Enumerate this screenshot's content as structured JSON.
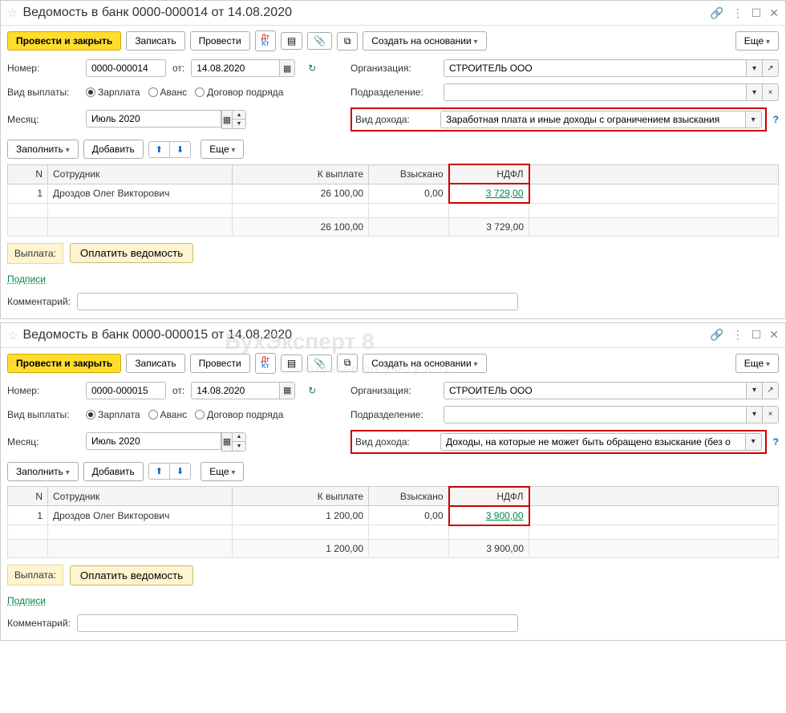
{
  "windows": [
    {
      "title": "Ведомость в банк 0000-000014 от 14.08.2020",
      "number": "0000-000014",
      "date": "14.08.2020",
      "org": "СТРОИТЕЛЬ ООО",
      "subdiv": "",
      "month": "Июль 2020",
      "income_type": "Заработная плата и иные доходы с ограничением взыскания",
      "row": {
        "n": "1",
        "emp": "Дроздов Олег Викторович",
        "amount": "26 100,00",
        "collected": "0,00",
        "ndfl": "3 729,00"
      },
      "total": {
        "amount": "26 100,00",
        "ndfl": "3 729,00"
      }
    },
    {
      "title": "Ведомость в банк 0000-000015 от 14.08.2020",
      "number": "0000-000015",
      "date": "14.08.2020",
      "org": "СТРОИТЕЛЬ ООО",
      "subdiv": "",
      "month": "Июль 2020",
      "income_type": "Доходы, на которые не может быть обращено взыскание (без о",
      "row": {
        "n": "1",
        "emp": "Дроздов Олег Викторович",
        "amount": "1 200,00",
        "collected": "0,00",
        "ndfl": "3 900,00"
      },
      "total": {
        "amount": "1 200,00",
        "ndfl": "3 900,00"
      }
    }
  ],
  "labels": {
    "post_close": "Провести и закрыть",
    "record": "Записать",
    "post": "Провести",
    "create_based": "Создать на основании",
    "more": "Еще",
    "number": "Номер:",
    "from": "от:",
    "org": "Организация:",
    "paytype": "Вид выплаты:",
    "salary": "Зарплата",
    "advance": "Аванс",
    "contract": "Договор подряда",
    "subdiv": "Подразделение:",
    "month": "Месяц:",
    "income_type": "Вид дохода:",
    "fill": "Заполнить",
    "add": "Добавить",
    "col_n": "N",
    "col_emp": "Сотрудник",
    "col_amt": "К выплате",
    "col_col": "Взыскано",
    "col_ndfl": "НДФЛ",
    "payment": "Выплата:",
    "pay_btn": "Оплатить ведомость",
    "signs": "Подписи",
    "comment": "Комментарий:"
  },
  "watermark": {
    "main": "БухЭксперт 8",
    "sub": "Ответов по учёту в 1С"
  }
}
